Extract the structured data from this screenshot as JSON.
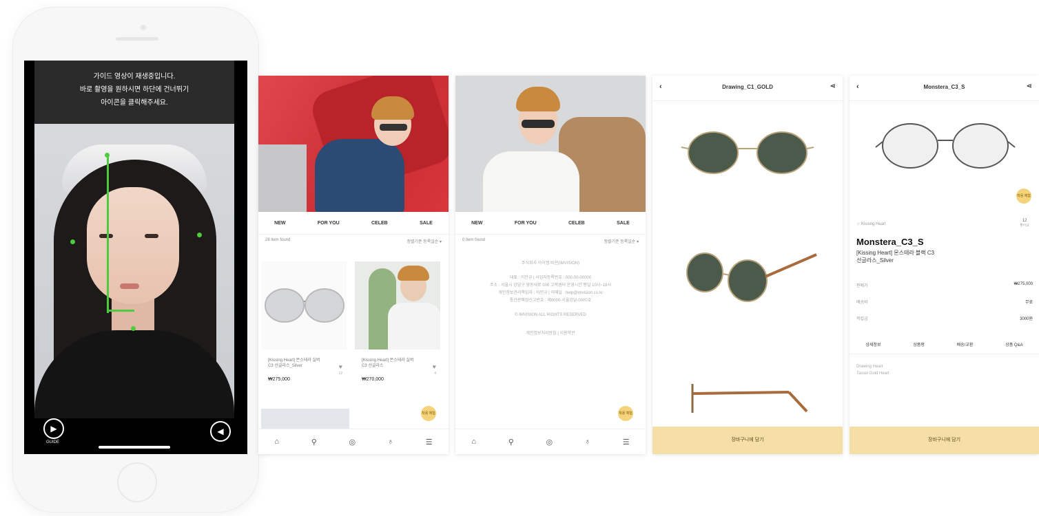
{
  "phone": {
    "guide_lines": [
      "가이드 영상이 재생중입니다.",
      "바로 촬영을 원하시면 하단에 건너뛰기",
      "아이콘을 클릭해주세요."
    ],
    "play_icon": "play-circle-icon",
    "play_caption": "GUIDE",
    "sound_icon": "speaker-icon"
  },
  "screen1": {
    "tabs": [
      "NEW",
      "FOR YOU",
      "CELEB",
      "SALE"
    ],
    "item_count": "28 item found",
    "sort_label": "정렬기준 등록일순 ▾",
    "products": [
      {
        "name": "[Kissing Heart] 몬스테라 실버 C3 선글라스_Silver",
        "price": "₩275,000",
        "heart": "♥",
        "heart_label": "12"
      },
      {
        "name": "[Kissing Heart] 몬스테라 실버 C3 선글라스",
        "price": "₩270,000",
        "heart": "♥",
        "heart_label": "4"
      }
    ],
    "badge": "착용 체험",
    "tabbar": [
      "⌂",
      "⚲",
      "◎",
      "♁",
      "☰"
    ]
  },
  "screen2": {
    "tabs": [
      "NEW",
      "FOR YOU",
      "CELEB",
      "SALE"
    ],
    "item_count": "0 item found",
    "sort_label": "정렬기준 등록일순 ▾",
    "info_lines": [
      "주식회사 아이엠 비전(IMVISION)",
      "대표 : 이민규 | 사업자등록번호 : 000-00-00000",
      "주소 : 서울시 강남구 영동대로 000 고객센터 운영시간 평일 10시~18시",
      "개인정보관리책임자 : 이민규 | 이메일 : help@imvision.co.kr",
      "통신판매업신고번호 : 제0000-서울강남-0000호",
      "© IMVISION ALL RIGHTS RESERVED",
      "개인정보처리방침  |  이용약관"
    ],
    "badge": "착용 체험",
    "tabbar": [
      "⌂",
      "⚲",
      "◎",
      "♁",
      "☰"
    ]
  },
  "screen3": {
    "back": "‹",
    "title": "Drawing_C1_GOLD",
    "share": "⋖",
    "cta": "장바구니에 담기"
  },
  "screen4": {
    "back": "‹",
    "title": "Monstera_C3_S",
    "share": "⋖",
    "brand": "☆ Kissing Heart",
    "product_title": "Monstera_C3_S",
    "subtitle_lines": [
      "[Kissing Heart] 몬스테라 블랙 C3",
      "선글라스_Silver"
    ],
    "like_count": "12",
    "like_label": "좋아요",
    "badge": "착용 체험",
    "specs": [
      {
        "label": "판매가",
        "value": "₩275,000"
      },
      {
        "label": "배송비",
        "value": "무료"
      },
      {
        "label": "적립금",
        "value": "3000원"
      }
    ],
    "detail_tabs": [
      "상세정보",
      "상품평",
      "배송/교환",
      "상품 Q&A"
    ],
    "description_lines": [
      "Drawing Heart",
      "Tassel Gold Heart"
    ],
    "cta": "장바구니에 담기"
  }
}
